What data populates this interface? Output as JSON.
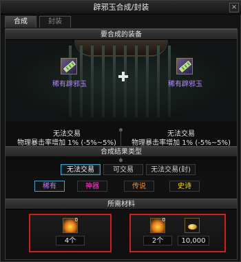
{
  "window": {
    "title": "辟邪玉合成/封装",
    "close_glyph": "×"
  },
  "tabs": [
    {
      "label": "合成",
      "active": true
    },
    {
      "label": "封装",
      "active": false
    }
  ],
  "sections": {
    "equip": "要合成的装备",
    "result_type": "合成结果类型",
    "materials": "所需材料"
  },
  "equip": {
    "left": {
      "name": "稀有辟邪玉",
      "icon": "jade-item-icon",
      "trade": "无法交易",
      "effect": "物理暴击率增加 1% (-5%~5%)"
    },
    "right": {
      "name": "稀有辟邪玉",
      "icon": "jade-item-icon",
      "trade": "无法交易",
      "effect": "物理暴击率增加 1% (-5%~5%)"
    },
    "plus_icon": "plus-icon"
  },
  "trade_options": [
    {
      "label": "无法交易",
      "selected": true
    },
    {
      "label": "可交易",
      "selected": false
    },
    {
      "label": "无法交易(封)",
      "selected": false
    }
  ],
  "grade_options": [
    {
      "label": "稀有",
      "color": "#c080ff",
      "selected": true
    },
    {
      "label": "神器",
      "color": "#ff40c8",
      "selected": false
    },
    {
      "label": "传说",
      "color": "#ff8a20",
      "selected": false
    },
    {
      "label": "史诗",
      "color": "#ffd820",
      "selected": false
    }
  ],
  "materials": [
    {
      "slots": [
        {
          "icon": "flame-material-icon",
          "badge": "0"
        }
      ],
      "count": "4个"
    },
    {
      "slots": [
        {
          "icon": "flame-material-icon",
          "badge": "0"
        },
        {
          "icon": "gold-icon"
        }
      ],
      "counts": [
        "2个",
        "10,000"
      ]
    }
  ],
  "colors": {
    "accent": "#4aa0c8",
    "highlight_border": "#d0201a",
    "rare_purple": "#b48cff"
  }
}
